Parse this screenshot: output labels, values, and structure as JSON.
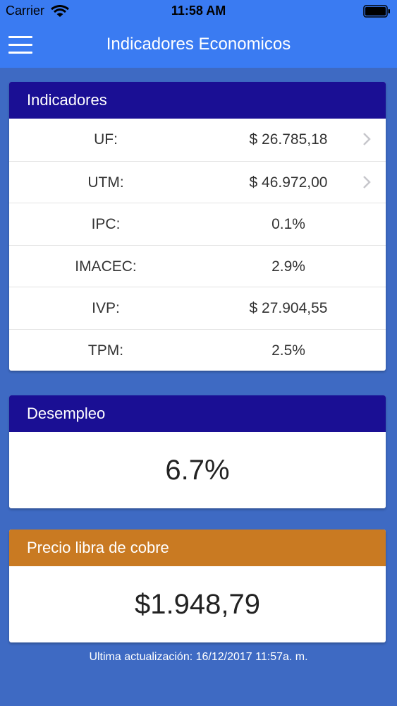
{
  "statusbar": {
    "carrier": "Carrier",
    "time": "11:58 AM"
  },
  "navbar": {
    "title": "Indicadores Economicos"
  },
  "indicadores": {
    "title": "Indicadores",
    "rows": [
      {
        "label": "UF:",
        "value": "$ 26.785,18"
      },
      {
        "label": "UTM:",
        "value": "$ 46.972,00"
      },
      {
        "label": "IPC:",
        "value": "0.1%"
      },
      {
        "label": "IMACEC:",
        "value": "2.9%"
      },
      {
        "label": "IVP:",
        "value": "$ 27.904,55"
      },
      {
        "label": "TPM:",
        "value": "2.5%"
      }
    ]
  },
  "desempleo": {
    "title": "Desempleo",
    "value": "6.7%"
  },
  "cobre": {
    "title": "Precio libra de cobre",
    "value": "$1.948,79"
  },
  "footer": {
    "text": "Ultima actualización: 16/12/2017 11:57a. m."
  },
  "colors": {
    "accent": "#3a7bf2",
    "header_blue": "#1a0f94",
    "header_orange": "#c97a22",
    "background": "#3e6ac3"
  }
}
